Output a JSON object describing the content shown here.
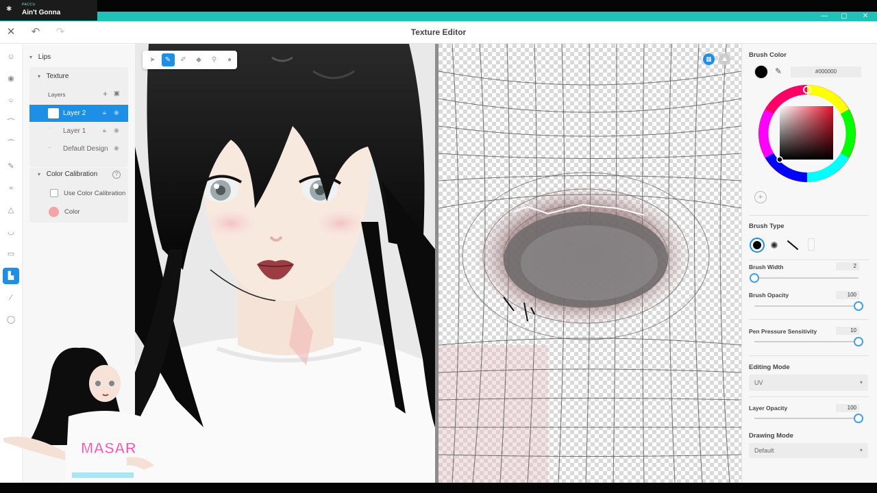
{
  "nowplaying": {
    "artist": "PACCU",
    "title": "Ain't Gonna"
  },
  "window": {
    "minimize": "—",
    "maximize": "▢",
    "close": "✕"
  },
  "header": {
    "title": "Texture Editor",
    "close": "✕",
    "undo": "↶",
    "redo": "↷"
  },
  "rail": [
    {
      "name": "face-icon",
      "glyph": "☺"
    },
    {
      "name": "eye-icon",
      "glyph": "◉"
    },
    {
      "name": "iris-icon",
      "glyph": "○"
    },
    {
      "name": "eyelash-icon",
      "glyph": "⌒"
    },
    {
      "name": "eyebrow-icon",
      "glyph": "⁀"
    },
    {
      "name": "brush-tool-icon",
      "glyph": "✎"
    },
    {
      "name": "eyeline-icon",
      "glyph": "≈"
    },
    {
      "name": "nose-icon",
      "glyph": "△"
    },
    {
      "name": "mouth-icon",
      "glyph": "◡"
    },
    {
      "name": "teeth-icon",
      "glyph": "▭"
    },
    {
      "name": "lips-icon",
      "glyph": "▙",
      "active": true
    },
    {
      "name": "accessory-icon",
      "glyph": "∕"
    },
    {
      "name": "ear-icon",
      "glyph": "◯"
    }
  ],
  "panel": {
    "section": "Lips",
    "texture": "Texture",
    "layers_label": "Layers",
    "add": "+",
    "add_folder": "▣",
    "layers": [
      {
        "name": "Layer 2",
        "selected": true
      },
      {
        "name": "Layer 1",
        "selected": false
      },
      {
        "name": "Default Design",
        "selected": false
      }
    ],
    "color_calibration": "Color Calibration",
    "help": "?",
    "use_color_calibration": "Use Color Calibration",
    "color_label": "Color",
    "calibration_color": "#f4a3a8"
  },
  "toolbar": {
    "tools": [
      {
        "name": "select-tool-icon",
        "glyph": "➤"
      },
      {
        "name": "pen-tool-icon",
        "glyph": "✎",
        "active": true
      },
      {
        "name": "eraser-tool-icon",
        "glyph": "✐"
      },
      {
        "name": "fill-tool-icon",
        "glyph": "◆"
      },
      {
        "name": "stamp-tool-icon",
        "glyph": "⚲"
      },
      {
        "name": "dropper-tool-icon",
        "glyph": "●"
      }
    ]
  },
  "right": {
    "brush_color": "Brush Color",
    "hex": "#000000",
    "current_color": "#000000",
    "brush_type": "Brush Type",
    "brush_width": "Brush Width",
    "brush_width_value": "2",
    "brush_width_level": 0.0,
    "brush_opacity": "Brush Opacity",
    "brush_opacity_value": "100",
    "brush_opacity_level": 1.0,
    "pen_pressure": "Pen Pressure Sensitivity",
    "pen_pressure_value": "10",
    "pen_pressure_level": 1.0,
    "editing_mode": "Editing Mode",
    "editing_mode_value": "UV",
    "layer_opacity": "Layer Opacity",
    "layer_opacity_value": "100",
    "layer_opacity_level": 1.0,
    "drawing_mode": "Drawing Mode",
    "drawing_mode_value": "Default",
    "add_swatch": "+"
  },
  "avatar_shirt_text": "MASAR",
  "colors": {
    "accent": "#1d8fe6",
    "titlebar": "#1fc2b8"
  }
}
